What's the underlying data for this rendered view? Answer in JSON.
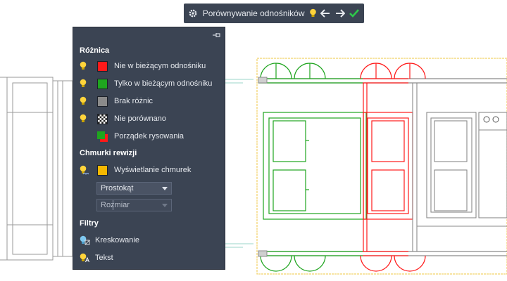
{
  "toolbar": {
    "title": "Porównywanie odnośników",
    "icons": [
      "gear-icon",
      "lightbulb-icon",
      "arrow-left-icon",
      "arrow-right-icon",
      "checkmark-icon"
    ]
  },
  "panel": {
    "difference": {
      "title": "Różnica",
      "items": [
        {
          "label": "Nie w bieżącym odnośniku",
          "color": "#ff1a1a"
        },
        {
          "label": "Tylko w bieżącym odnośniku",
          "color": "#1fa51f"
        },
        {
          "label": "Brak różnic",
          "color": "#8a8a8a"
        },
        {
          "label": "Nie porównano",
          "pattern": "checker"
        },
        {
          "label": "Porządek rysowania",
          "pattern": "red-green"
        }
      ]
    },
    "revision_clouds": {
      "title": "Chmurki rewizji",
      "display_label": "Wyświetlanie chmurek",
      "display_color": "#f5b800",
      "shape_value": "Prostokąt",
      "size_value": "Rozmiar"
    },
    "filters": {
      "title": "Filtry",
      "hatching_label": "Kreskowanie",
      "text_label": "Tekst"
    }
  },
  "colors": {
    "removed": "#ff1a1a",
    "added": "#1fa51f",
    "unchanged": "#8a8a8a",
    "cloud_border": "#f2d36b",
    "panel_bg": "#3b4453"
  }
}
